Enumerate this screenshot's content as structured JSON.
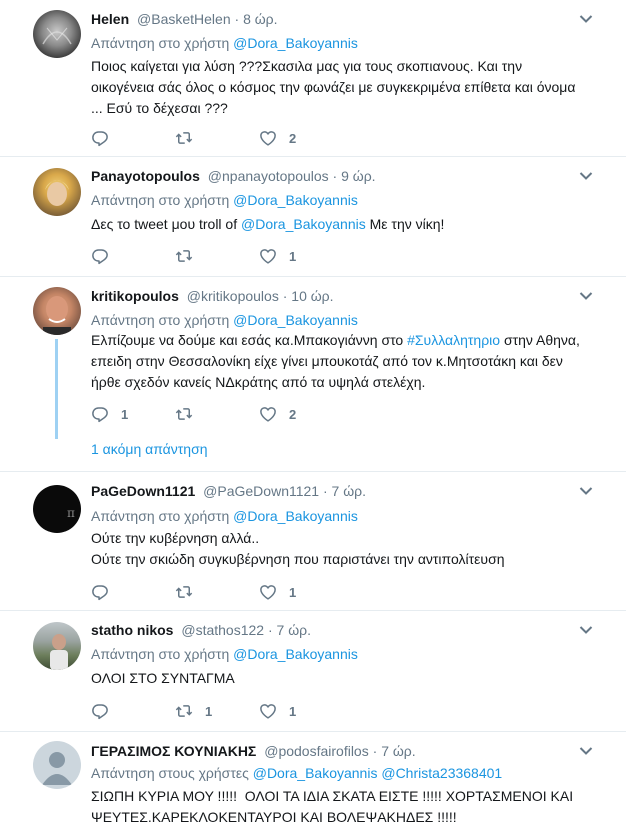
{
  "tweets": [
    {
      "name": "Helen",
      "handle": "@BasketHelen",
      "sep": " · ",
      "time": "8 ώρ.",
      "reply_prefix": "Απάντηση στο χρήστη ",
      "reply_users": [
        "@Dora_Bakoyannis"
      ],
      "lines": [
        "Ποιος καίγεται για λύση ???Σκασιλα μας για τους σκοπιανους. Και την",
        "οικογένεια σάς όλος ο κόσμος την φωνάζει με συγκεκριμένα επίθετα και όνομα",
        "... Εσύ το δέχεσαι ???"
      ],
      "reply_count": "",
      "retweet_count": "",
      "like_count": "2",
      "avatar_icon": "dark-photo-avatar"
    },
    {
      "name": "Panayotopoulos",
      "handle": "@npanayotopoulos",
      "sep": " · ",
      "time": "9 ώρ.",
      "reply_prefix": "Απάντηση στο χρήστη ",
      "reply_users": [
        "@Dora_Bakoyannis"
      ],
      "text_pre": "Δες το tweet μου troll of ",
      "text_link": "@Dora_Bakoyannis",
      "text_post": " Με την νίκη!",
      "reply_count": "",
      "retweet_count": "",
      "like_count": "1",
      "avatar_icon": "blond-person-avatar"
    },
    {
      "name": "kritikopoulos",
      "handle": "@kritikopoulos",
      "sep": " · ",
      "time": "10 ώρ.",
      "reply_prefix": "Απάντηση στο χρήστη ",
      "reply_users": [
        "@Dora_Bakoyannis"
      ],
      "line1_pre": "Ελπίζουμε να δούμε και εσάς κα.Μπακογιάννη στο ",
      "line1_link": "#Συλλαλητηριο",
      "line1_post": " στην Αθηνα,",
      "line2": "επειδη στην Θεσσαλονίκη είχε γίνει μπουκοτάζ από τον κ.Μητσοτάκη και δεν",
      "line3": "ήρθε σχεδόν κανείς ΝΔκράτης από τα υψηλά στελέχη.",
      "reply_count": "1",
      "retweet_count": "",
      "like_count": "2",
      "more_replies": "1 ακόμη απάντηση",
      "avatar_icon": "bald-man-avatar"
    },
    {
      "name": "PaGeDown1121",
      "handle": "@PaGeDown1121",
      "sep": " · ",
      "time": "7 ώρ.",
      "reply_prefix": "Απάντηση στο χρήστη ",
      "reply_users": [
        "@Dora_Bakoyannis"
      ],
      "lines": [
        "Ούτε την κυβέρνηση αλλά..",
        "Ούτε την σκιώδη συγκυβέρνηση που παριστάνει την αντιπολίτευση"
      ],
      "reply_count": "",
      "retweet_count": "",
      "like_count": "1",
      "avatar_icon": "pi-symbol-avatar"
    },
    {
      "name": "statho nikos",
      "handle": "@stathos122",
      "sep": " · ",
      "time": "7 ώρ.",
      "reply_prefix": "Απάντηση στο χρήστη ",
      "reply_users": [
        "@Dora_Bakoyannis"
      ],
      "lines": [
        "ΟΛΟΙ ΣΤΟ ΣΥΝΤΑΓΜΑ"
      ],
      "reply_count": "",
      "retweet_count": "1",
      "like_count": "1",
      "avatar_icon": "outdoor-man-avatar"
    },
    {
      "name": "ΓΕΡΑΣΙΜΟΣ ΚΟΥΝΙΑΚΗΣ",
      "handle": "@podosfairofilos",
      "sep": " · ",
      "time": "7 ώρ.",
      "reply_prefix": "Απάντηση στους χρήστες ",
      "reply_users": [
        "@Dora_Bakoyannis",
        "@Christa23368401"
      ],
      "lines": [
        "ΣΙΩΠΗ ΚΥΡΙΑ ΜΟΥ !!!!!  ΟΛΟΙ ΤΑ ΙΔΙΑ ΣΚΑΤΑ ΕΙΣΤΕ !!!!! ΧΟΡΤΑΣΜΕΝΟΙ ΚΑΙ",
        "ΨΕΥΤΕΣ.ΚΑΡΕΚΛΟΚΕΝΤΑΥΡΟΙ ΚΑΙ ΒΟΛΕΨΑΚΗΔΕΣ !!!!!"
      ],
      "avatar_icon": "default-profile-avatar"
    }
  ],
  "colors": {
    "link": "#1b95e0",
    "muted": "#657786",
    "text": "#14171a",
    "divider": "#e6ecf0",
    "thread": "#9ed1f3"
  }
}
